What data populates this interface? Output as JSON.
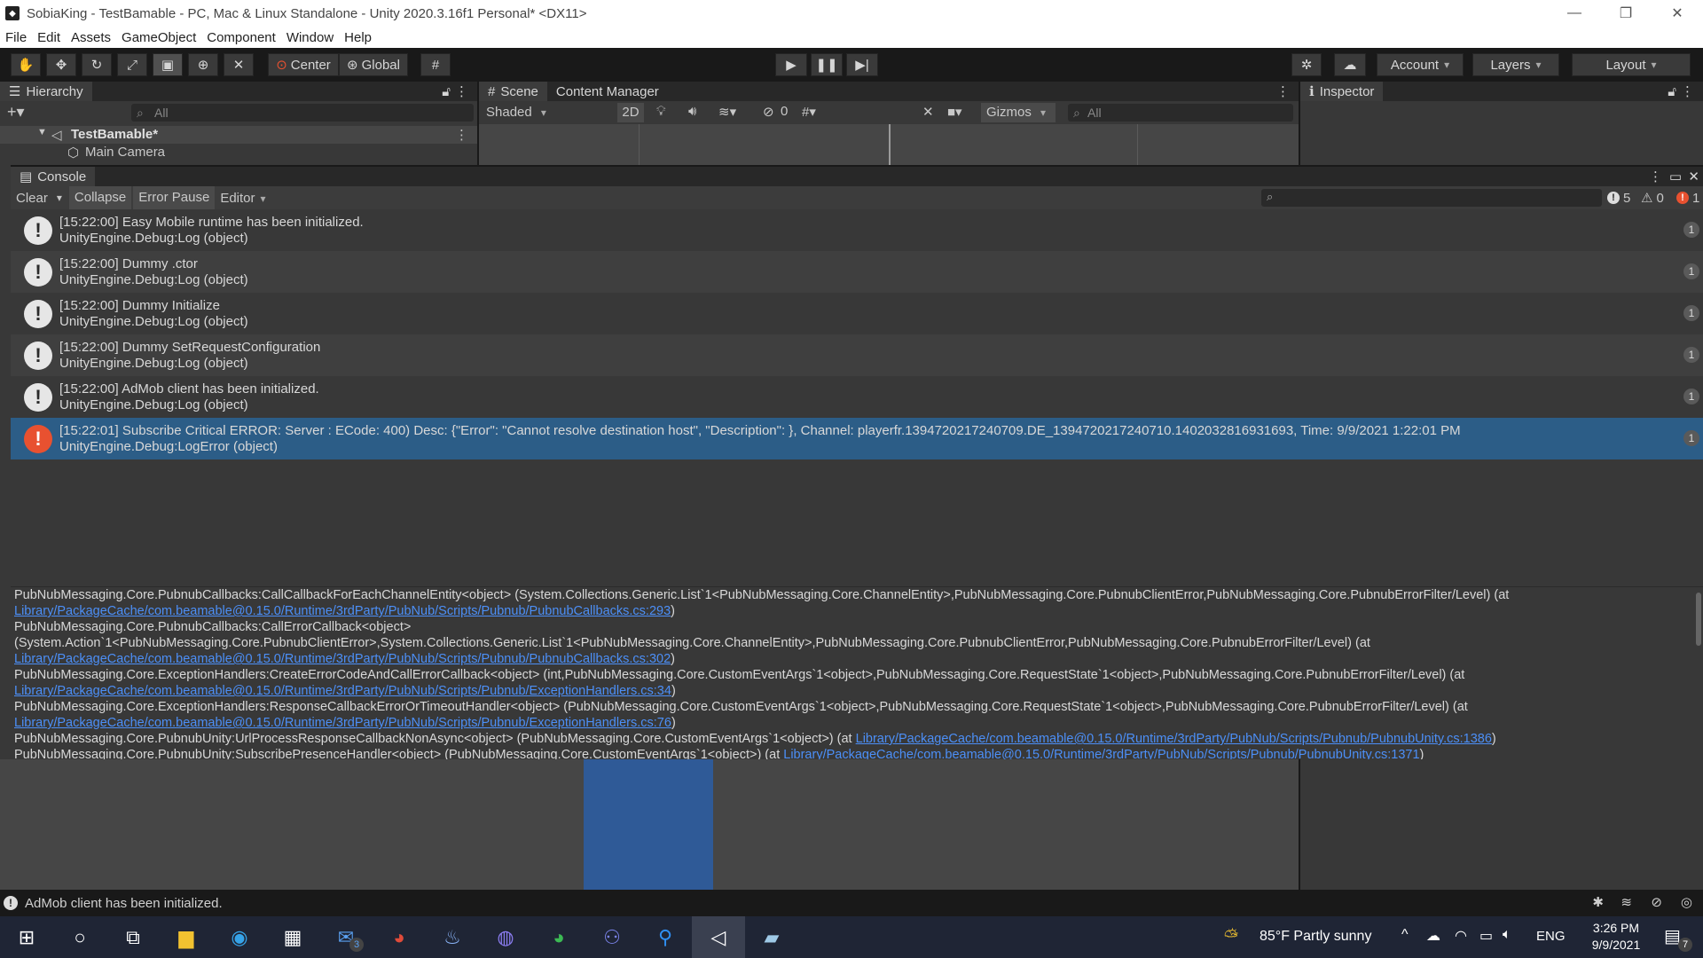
{
  "window": {
    "title": "SobiaKing - TestBamable - PC, Mac & Linux Standalone - Unity 2020.3.16f1 Personal* <DX11>",
    "controls": [
      "—",
      "❐",
      "✕"
    ]
  },
  "menu": [
    "File",
    "Edit",
    "Assets",
    "GameObject",
    "Component",
    "Window",
    "Help"
  ],
  "toolbar": {
    "center_label": "Center",
    "global_label": "Global",
    "account_label": "Account",
    "layers_label": "Layers",
    "layout_label": "Layout"
  },
  "hierarchy": {
    "tab_label": "Hierarchy",
    "search_placeholder": "All",
    "scene_name": "TestBamable*",
    "items": [
      "Main Camera"
    ]
  },
  "scene": {
    "tabs": [
      "Scene",
      "Content Manager"
    ],
    "shading": "Shaded",
    "mode_2d": "2D",
    "hidden_count": "0",
    "gizmos_label": "Gizmos",
    "search_placeholder": "All"
  },
  "inspector": {
    "tab_label": "Inspector"
  },
  "console": {
    "tab_label": "Console",
    "clear_label": "Clear",
    "collapse_label": "Collapse",
    "error_pause_label": "Error Pause",
    "editor_label": "Editor",
    "log_count": "5",
    "warn_count": "0",
    "error_count": "1",
    "entries": [
      {
        "line1": "[15:22:00] Easy Mobile runtime has been initialized.",
        "line2": "UnityEngine.Debug:Log (object)",
        "count": "1",
        "level": "log"
      },
      {
        "line1": "[15:22:00] Dummy .ctor",
        "line2": "UnityEngine.Debug:Log (object)",
        "count": "1",
        "level": "log"
      },
      {
        "line1": "[15:22:00] Dummy Initialize",
        "line2": "UnityEngine.Debug:Log (object)",
        "count": "1",
        "level": "log"
      },
      {
        "line1": "[15:22:00] Dummy SetRequestConfiguration",
        "line2": "UnityEngine.Debug:Log (object)",
        "count": "1",
        "level": "log"
      },
      {
        "line1": "[15:22:00] AdMob client has been initialized.",
        "line2": "UnityEngine.Debug:Log (object)",
        "count": "1",
        "level": "log"
      },
      {
        "line1": "[15:22:01] Subscribe Critical ERROR: Server : ECode: 400) Desc: {\"Error\": \"Cannot resolve destination host\", \"Description\": }, Channel: playerfr.1394720217240709.DE_1394720217240710.1402032816931693, Time: 9/9/2021 1:22:01 PM",
        "line2": "UnityEngine.Debug:LogError (object)",
        "count": "1",
        "level": "error"
      }
    ],
    "detail": [
      {
        "text": "PubNubMessaging.Core.PubnubCallbacks:CallCallbackForEachChannelEntity<object> (System.Collections.Generic.List`1<PubNubMessaging.Core.ChannelEntity>,PubNubMessaging.Core.PubnubClientError,PubNubMessaging.Core.PubnubErrorFilter/Level) (at",
        "link": ""
      },
      {
        "text": "",
        "link": "Library/PackageCache/com.beamable@0.15.0/Runtime/3rdParty/PubNub/Scripts/Pubnub/PubnubCallbacks.cs:293",
        "suffix": ")"
      },
      {
        "text": "PubNubMessaging.Core.PubnubCallbacks:CallErrorCallback<object>",
        "link": ""
      },
      {
        "text": "(System.Action`1<PubNubMessaging.Core.PubnubClientError>,System.Collections.Generic.List`1<PubNubMessaging.Core.ChannelEntity>,PubNubMessaging.Core.PubnubClientError,PubNubMessaging.Core.PubnubErrorFilter/Level) (at",
        "link": ""
      },
      {
        "text": "",
        "link": "Library/PackageCache/com.beamable@0.15.0/Runtime/3rdParty/PubNub/Scripts/Pubnub/PubnubCallbacks.cs:302",
        "suffix": ")"
      },
      {
        "text": "PubNubMessaging.Core.ExceptionHandlers:CreateErrorCodeAndCallErrorCallback<object> (int,PubNubMessaging.Core.CustomEventArgs`1<object>,PubNubMessaging.Core.RequestState`1<object>,PubNubMessaging.Core.PubnubErrorFilter/Level) (at",
        "link": ""
      },
      {
        "text": "",
        "link": "Library/PackageCache/com.beamable@0.15.0/Runtime/3rdParty/PubNub/Scripts/Pubnub/ExceptionHandlers.cs:34",
        "suffix": ")"
      },
      {
        "text": "PubNubMessaging.Core.ExceptionHandlers:ResponseCallbackErrorOrTimeoutHandler<object> (PubNubMessaging.Core.CustomEventArgs`1<object>,PubNubMessaging.Core.RequestState`1<object>,PubNubMessaging.Core.PubnubErrorFilter/Level) (at",
        "link": ""
      },
      {
        "text": "",
        "link": "Library/PackageCache/com.beamable@0.15.0/Runtime/3rdParty/PubNub/Scripts/Pubnub/ExceptionHandlers.cs:76",
        "suffix": ")"
      },
      {
        "text": "PubNubMessaging.Core.PubnubUnity:UrlProcessResponseCallbackNonAsync<object> (PubNubMessaging.Core.CustomEventArgs`1<object>) (at ",
        "link": "Library/PackageCache/com.beamable@0.15.0/Runtime/3rdParty/PubNub/Scripts/Pubnub/PubnubUnity.cs:1386",
        "suffix": ")"
      },
      {
        "text": "PubNubMessaging.Core.PubnubUnity:SubscribePresenceHandler<object> (PubNubMessaging.Core.CustomEventArgs`1<object>) (at ",
        "link": "Library/PackageCache/com.beamable@0.15.0/Runtime/3rdParty/PubNub/Scripts/Pubnub/PubnubUnity.cs:1371",
        "suffix": ")"
      }
    ]
  },
  "status": {
    "message": "AdMob client has been initialized."
  },
  "taskbar": {
    "mail_badge": "3",
    "weather": "85°F  Partly sunny",
    "language": "ENG",
    "time": "3:26 PM",
    "date": "9/9/2021",
    "notif_count": "7"
  },
  "colors": {
    "selection": "#2c5d87",
    "error": "#e85130",
    "link": "#4c8ff7"
  }
}
